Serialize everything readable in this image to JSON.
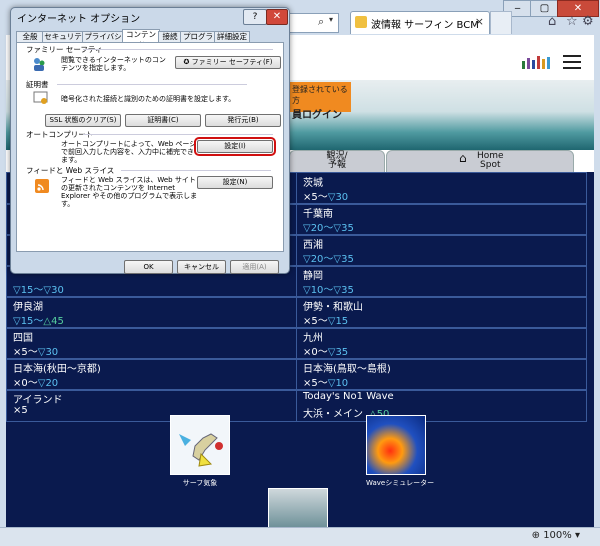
{
  "browser": {
    "tab_title": "波情報 サーフィン BCM",
    "zoom": "100%"
  },
  "site": {
    "login_banner_line1": "登録されている方",
    "login_banner_line2": "員ログイン",
    "tabs": [
      {
        "label": "観況/\n予報"
      },
      {
        "label": "Home\nSpot"
      }
    ],
    "regions": [
      {
        "name": "",
        "value_prefix": "",
        "value_tail": "",
        "value_tail2": ""
      },
      {
        "name": "茨城",
        "value_prefix": "×5〜",
        "value_tail": "▽30",
        "value_tail2": ""
      },
      {
        "name": "",
        "value_prefix": "",
        "value_tail": "",
        "value_tail2": ""
      },
      {
        "name": "千葉南",
        "value_prefix": "",
        "value_tail": "▽20〜▽35",
        "value_tail2": ""
      },
      {
        "name": "",
        "value_prefix": "",
        "value_tail": "",
        "value_tail2": ""
      },
      {
        "name": "西湘",
        "value_prefix": "",
        "value_tail": "▽20〜▽35",
        "value_tail2": ""
      },
      {
        "name": "",
        "value_prefix": "",
        "value_tail": "▽15〜▽30",
        "value_tail2": ""
      },
      {
        "name": "静岡",
        "value_prefix": "",
        "value_tail": "▽10〜▽35",
        "value_tail2": ""
      },
      {
        "name": "伊良湖",
        "value_prefix": "",
        "value_tail": "▽15〜",
        "value_tail2": "△45"
      },
      {
        "name": "伊勢・和歌山",
        "value_prefix": "×5〜",
        "value_tail": "▽15",
        "value_tail2": ""
      },
      {
        "name": "四国",
        "value_prefix": "×5〜",
        "value_tail": "▽30",
        "value_tail2": ""
      },
      {
        "name": "九州",
        "value_prefix": "×0〜",
        "value_tail": "▽35",
        "value_tail2": ""
      },
      {
        "name": "日本海(秋田〜京都)",
        "value_prefix": "×0〜",
        "value_tail": "▽20",
        "value_tail2": ""
      },
      {
        "name": "日本海(鳥取〜島根)",
        "value_prefix": "×5〜",
        "value_tail": "▽10",
        "value_tail2": ""
      },
      {
        "name": "アイランド",
        "value_prefix": "×5",
        "value_tail": "",
        "value_tail2": ""
      },
      {
        "name": "Today's No1 Wave",
        "value_prefix": "大浜・メイン",
        "value_tail": "",
        "value_tail2": "△50"
      }
    ],
    "cards": [
      {
        "label": "サーフ気象"
      },
      {
        "label": "Waveシミュレーター"
      }
    ]
  },
  "dialog": {
    "title": "インターネット オプション",
    "help": "?",
    "close": "✕",
    "tabs": [
      "全般",
      "セキュリティ",
      "プライバシー",
      "コンテンツ",
      "接続",
      "プログラム",
      "詳細設定"
    ],
    "family_safety": {
      "header": "ファミリー セーフティ",
      "desc": "閲覧できるインターネットのコンテンツを指定します。",
      "button": "ファミリー セーフティ(F)"
    },
    "certificates": {
      "header": "証明書",
      "desc": "暗号化された接続と識別のための証明書を設定します。",
      "btn_clear_ssl": "SSL 状態のクリア(S)",
      "btn_certs": "証明書(C)",
      "btn_publishers": "発行元(B)"
    },
    "autocomplete": {
      "header": "オートコンプリート",
      "desc": "オートコンプリートによって、Web ページで前回入力した内容を、入力中に補完できます。",
      "button": "設定(I)"
    },
    "feeds": {
      "header": "フィードと Web スライス",
      "desc": "フィードと Web スライスは、Web サイトの更新されたコンテンツを Internet Explorer やその他のプログラムで表示します。",
      "button": "設定(N)"
    },
    "ok": "OK",
    "cancel": "キャンセル",
    "apply": "適用(A)"
  }
}
